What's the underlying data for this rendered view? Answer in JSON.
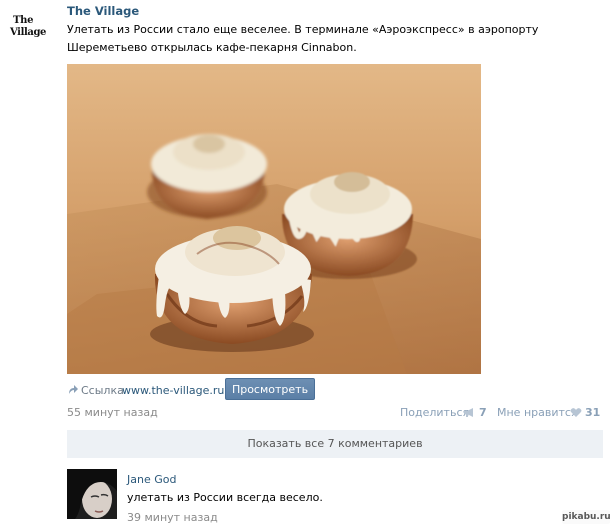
{
  "post": {
    "author": "The Village",
    "logo_line1": "The",
    "logo_line2": "Village",
    "text": "Улетать из России стало еще веселее. В терминале «Аэроэкспресс» в аэропорту Шереметьево открылась кафе-пекарня Cinnabon.",
    "link_label": "Ссылка",
    "link_url": "www.the-village.ru",
    "view_button": "Просмотреть",
    "timestamp": "55 минут назад",
    "share_label": "Поделиться",
    "share_count": "7",
    "like_label": "Мне нравится",
    "like_count": "31"
  },
  "comments": {
    "show_all_label": "Показать все 7 комментариев",
    "items": [
      {
        "author": "Jane God",
        "text": "улетать из России всегда весело.",
        "time": "39 минут назад"
      }
    ]
  },
  "watermark": "pikabu.ru",
  "colors": {
    "link": "#2b587a",
    "muted": "#8a8a8a",
    "button": "#5b7fa6",
    "bar": "#edf1f5"
  },
  "icons": {
    "share": "share-arrow-icon",
    "megaphone": "megaphone-icon",
    "heart": "heart-icon"
  }
}
